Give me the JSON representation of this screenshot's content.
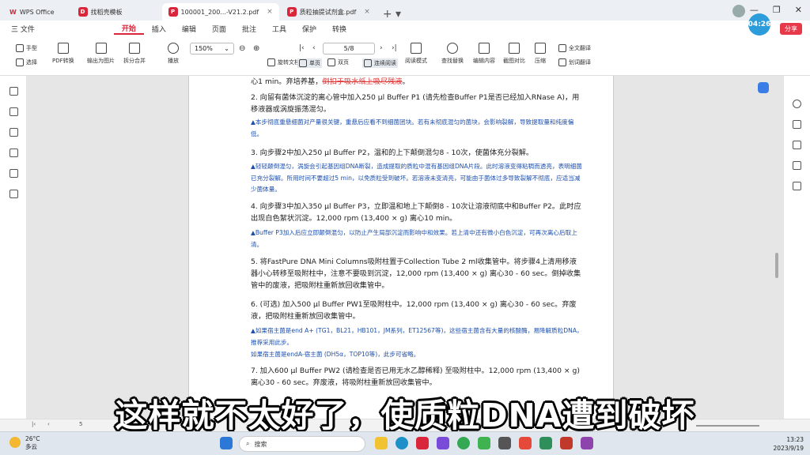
{
  "tabs": [
    {
      "label": "WPS Office",
      "active": false
    },
    {
      "label": "找稻壳模板",
      "active": false
    },
    {
      "label": "100001_200...-V21.2.pdf",
      "active": true
    },
    {
      "label": "质粒抽提试剂盒.pdf",
      "active": false
    }
  ],
  "menu": [
    "三 文件",
    "开始",
    "插入",
    "编辑",
    "页面",
    "批注",
    "工具",
    "保护",
    "转换"
  ],
  "menu_active": "开始",
  "clock_badge": "04:26",
  "share_label": "分享",
  "toolbar": {
    "hand": "手型",
    "select": "选择",
    "pdf_convert": "PDF转换",
    "export_image": "输出为图片",
    "split_merge": "拆分合并",
    "play": "播放",
    "zoom": "150%",
    "page": "5/8",
    "rotate": "旋转文档",
    "single": "单页",
    "double": "双页",
    "continuous": "连续阅读",
    "read_mode": "阅读模式",
    "find_replace": "查找替换",
    "edit_content": "编辑内容",
    "crop": "截图对比",
    "compress": "压缩",
    "full_translate": "全文翻译",
    "word_translate": "划词翻译"
  },
  "doc": {
    "line0_a": "心1 min。弃培养基，",
    "line0_b": "倒扣于吸水纸上吸尽残液",
    "line0_c": "。",
    "p2": "2. 向留有菌体沉淀的离心管中加入250 µl Buffer P1 (请先检查Buffer P1是否已经加入RNase A)，用移液器或涡旋振荡混匀。",
    "n2": "▲本步彻底重悬细菌对产量很关键，重悬后应看不到细菌团块。若有未彻底混匀的菌块，会影响裂解，导致提取量和纯度偏低。",
    "p3": "3. 向步骤2中加入250 µl Buffer P2，温和的上下颠倒混匀8 - 10次，使菌体充分裂解。",
    "n3": "▲轻轻颠倒混匀，涡旋会引起基因组DNA断裂，造成提取的质粒中混有基因组DNA片段。此时溶液变得粘稠而透亮，表明细菌已充分裂解。所用时间不要超过5 min，以免质粒受到破坏。若溶液未变清亮，可能由于菌体过多导致裂解不彻底，应适当减少菌体量。",
    "p4": "4. 向步骤3中加入350 µl Buffer P3，立即温和地上下颠倒8 - 10次让溶液彻底中和Buffer P2。此时应出现白色絮状沉淀。12,000 rpm (13,400 × g) 离心10 min。",
    "n4": "▲Buffer P3加入后应立即颠倒混匀，以防止产生局部沉淀而影响中和效果。若上清中还有微小白色沉淀，可再次离心后取上清。",
    "p5": "5. 将FastPure DNA Mini Columns吸附柱置于Collection Tube 2 ml收集管中。将步骤4上清用移液器小心转移至吸附柱中，注意不要吸到沉淀，12,000 rpm (13,400 × g) 离心30 - 60 sec。倒掉收集管中的废液，把吸附柱重新放回收集管中。",
    "p6": "6. (可选) 加入500 µl Buffer PW1至吸附柱中。12,000 rpm (13,400 × g) 离心30 - 60 sec。弃废液，把吸附柱重新放回收集管中。",
    "n6a": "▲如果宿主菌是end A+ (TG1，BL21，HB101，JM系列，ET12567等)，这些宿主菌含有大量的核酸酶，易降解质粒DNA，推荐采用此步。",
    "n6b": "如果宿主菌是endA-宿主菌 (DH5α，TOP10等)，此步可省略。",
    "p7": "7. 加入600 µl Buffer PW2 (请检查是否已用无水乙醇稀释) 至吸附柱中。12,000 rpm (13,400 × g) 离心30 - 60 sec。弃废液，将吸附柱重新放回收集管中。"
  },
  "subtitle": "这样就不太好了，使质粒DNA遭到破坏",
  "statusbar_page": "5",
  "taskbar": {
    "temp": "26°C",
    "weather": "多云",
    "search": "搜索",
    "time": "13:23",
    "date": "2023/9/19"
  }
}
